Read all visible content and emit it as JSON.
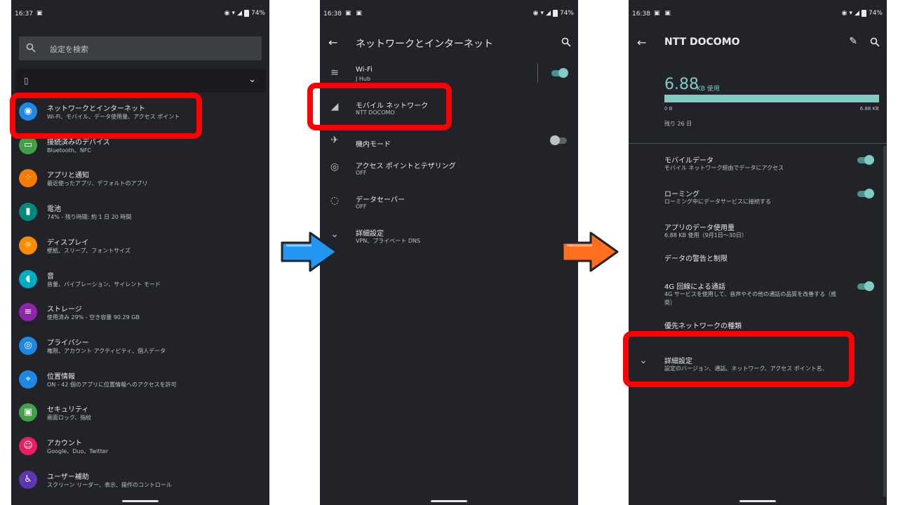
{
  "p1": {
    "status": {
      "time": "16:37",
      "battery": "74%"
    },
    "search_placeholder": "設定を検索",
    "items": [
      {
        "title": "ネットワークとインターネット",
        "sub": "Wi-Fi、モバイル、データ使用量、アクセス ポイント",
        "color": "#1e88e5",
        "icon": "wifi-icon"
      },
      {
        "title": "接続済みのデバイス",
        "sub": "Bluetooth、NFC",
        "color": "#43a047",
        "icon": "devices-icon"
      },
      {
        "title": "アプリと通知",
        "sub": "最近使ったアプリ、デフォルトのアプリ",
        "color": "#f57c00",
        "icon": "apps-icon"
      },
      {
        "title": "電池",
        "sub": "74% - 残り時間: 約 1 日 20 時間",
        "color": "#00897b",
        "icon": "battery-icon"
      },
      {
        "title": "ディスプレイ",
        "sub": "壁紙、スリープ、フォントサイズ",
        "color": "#fb8c00",
        "icon": "display-icon"
      },
      {
        "title": "音",
        "sub": "音量、バイブレーション、サイレント モード",
        "color": "#00acc1",
        "icon": "sound-icon"
      },
      {
        "title": "ストレージ",
        "sub": "使用済み 29% - 空き容量 90.29 GB",
        "color": "#8e24aa",
        "icon": "storage-icon"
      },
      {
        "title": "プライバシー",
        "sub": "権限、アカウント アクティビティ、個人データ",
        "color": "#1e88e5",
        "icon": "privacy-icon"
      },
      {
        "title": "位置情報",
        "sub": "ON - 42 個のアプリに位置情報へのアクセスを許可",
        "color": "#1e88e5",
        "icon": "location-icon"
      },
      {
        "title": "セキュリティ",
        "sub": "画面ロック、指紋",
        "color": "#43a047",
        "icon": "lock-icon"
      },
      {
        "title": "アカウント",
        "sub": "Google、Duo、Twitter",
        "color": "#e91e63",
        "icon": "account-icon"
      },
      {
        "title": "ユーザー補助",
        "sub": "スクリーン リーダー、表示、操作のコントロール",
        "color": "#5e35b1",
        "icon": "accessibility-icon"
      }
    ]
  },
  "p2": {
    "status": {
      "time": "16:38",
      "battery": "74%"
    },
    "title": "ネットワークとインターネット",
    "rows": [
      {
        "title": "Wi-Fi",
        "sub": "J Hub",
        "icon": "wifi-icon",
        "glyph": "≋",
        "toggle": "on"
      },
      {
        "title": "モバイル ネットワーク",
        "sub": "NTT DOCOMO",
        "icon": "signal-icon",
        "glyph": "◢",
        "toggle": ""
      },
      {
        "title": "機内モード",
        "sub": "",
        "icon": "airplane-icon",
        "glyph": "✈",
        "toggle": "off"
      },
      {
        "title": "アクセス ポイントとテザリング",
        "sub": "OFF",
        "icon": "hotspot-icon",
        "glyph": "◎",
        "toggle": ""
      },
      {
        "title": "データセーバー",
        "sub": "OFF",
        "icon": "data-saver-icon",
        "glyph": "◌",
        "toggle": ""
      },
      {
        "title": "詳細設定",
        "sub": "VPN、プライベート DNS",
        "icon": "chevron-down-icon",
        "glyph": "⌄",
        "toggle": ""
      }
    ]
  },
  "p3": {
    "status": {
      "time": "16:38",
      "battery": "74%"
    },
    "title": "NTT DOCOMO",
    "usage": {
      "value": "6.88",
      "unit": "KB 使用",
      "min": "0 B",
      "max": "6.88 KB",
      "fill": 1.0,
      "remaining": "残り 26 日"
    },
    "rows": [
      {
        "title": "モバイルデータ",
        "sub": "モバイル ネットワーク経由でデータにアクセス",
        "toggle": "on"
      },
      {
        "title": "ローミング",
        "sub": "ローミング中にデータサービスに接続する",
        "toggle": "on"
      },
      {
        "title": "アプリのデータ使用量",
        "sub": "6.88 KB 使用（9月1日〜30日）",
        "toggle": ""
      },
      {
        "title": "データの警告と制限",
        "sub": "",
        "toggle": ""
      },
      {
        "title": "4G 回線による通話",
        "sub": "4G サービスを使用して、音声やその他の通話の品質を改善する（推",
        "sub2": "奨）",
        "toggle": "on"
      },
      {
        "title": "優先ネットワークの種類",
        "sub": "",
        "toggle": ""
      },
      {
        "title": "詳細設定",
        "sub": "設定のバージョン、通話、ネットワーク、アクセス ポイント名、",
        "toggle": ""
      }
    ]
  },
  "colors": {
    "highlight": "#ff0000",
    "arrow1": "#2196f3",
    "arrow2": "#ff6d1f",
    "accent": "#80cbc4"
  }
}
